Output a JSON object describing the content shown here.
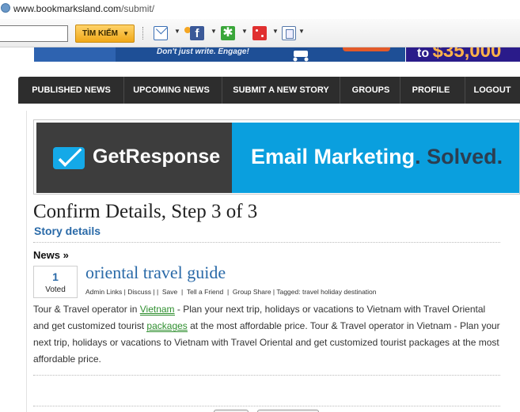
{
  "browser": {
    "url_domain": "www.bookmarksland.com",
    "url_path": "/submit/"
  },
  "toolbar": {
    "search_value": "",
    "search_button_label": "TÌM KIẾM",
    "icons": [
      "mail-icon",
      "facebook-icon",
      "green-star-icon",
      "red-dice-icon",
      "pages-icon"
    ],
    "facebook_letter": "f",
    "green_glyph": "✱"
  },
  "top_banners": {
    "left_text": "Don't just write. Engage!",
    "right_prefix": "to ",
    "right_amount": "$35,000"
  },
  "nav": {
    "items": [
      {
        "label": "PUBLISHED NEWS"
      },
      {
        "label": "UPCOMING NEWS"
      },
      {
        "label": "SUBMIT A NEW STORY"
      },
      {
        "label": "GROUPS"
      },
      {
        "label": "PROFILE"
      },
      {
        "label": "LOGOUT"
      }
    ]
  },
  "ad": {
    "brand": "GetResponse",
    "tagline_1": "Email Marketing",
    "tagline_dot": ".",
    "tagline_2": " Solved."
  },
  "page": {
    "title": "Confirm Details, Step 3 of 3",
    "subtitle": "Story details",
    "section": "News »"
  },
  "story": {
    "votes": "1",
    "votes_label": "Voted",
    "title": "oriental travel guide",
    "meta": {
      "admin_links": "Admin Links",
      "discuss": "Discuss",
      "save": "Save",
      "tell_friend": "Tell a Friend",
      "group_share": "Group Share",
      "tagged": "Tagged: travel holiday destination"
    },
    "body_1": "Tour & Travel operator in ",
    "link_1": "Vietnam",
    "body_2": " - Plan your next trip, holidays or vacations to Vietnam with Travel Oriental and get customized tourist ",
    "link_2": "packages",
    "body_3": " at the most affordable price. Tour & Travel operator in Vietnam - Plan your next trip, holidays or vacations to Vietnam with Travel Oriental and get customized tourist packages at the most affordable price."
  },
  "colors": {
    "nav_bg": "#2d2d2d",
    "link_blue": "#2a6aa8",
    "ad_blue": "#0a9fde",
    "ad_dark": "#3d3d3d",
    "highlight_green": "#2f8f2f"
  }
}
